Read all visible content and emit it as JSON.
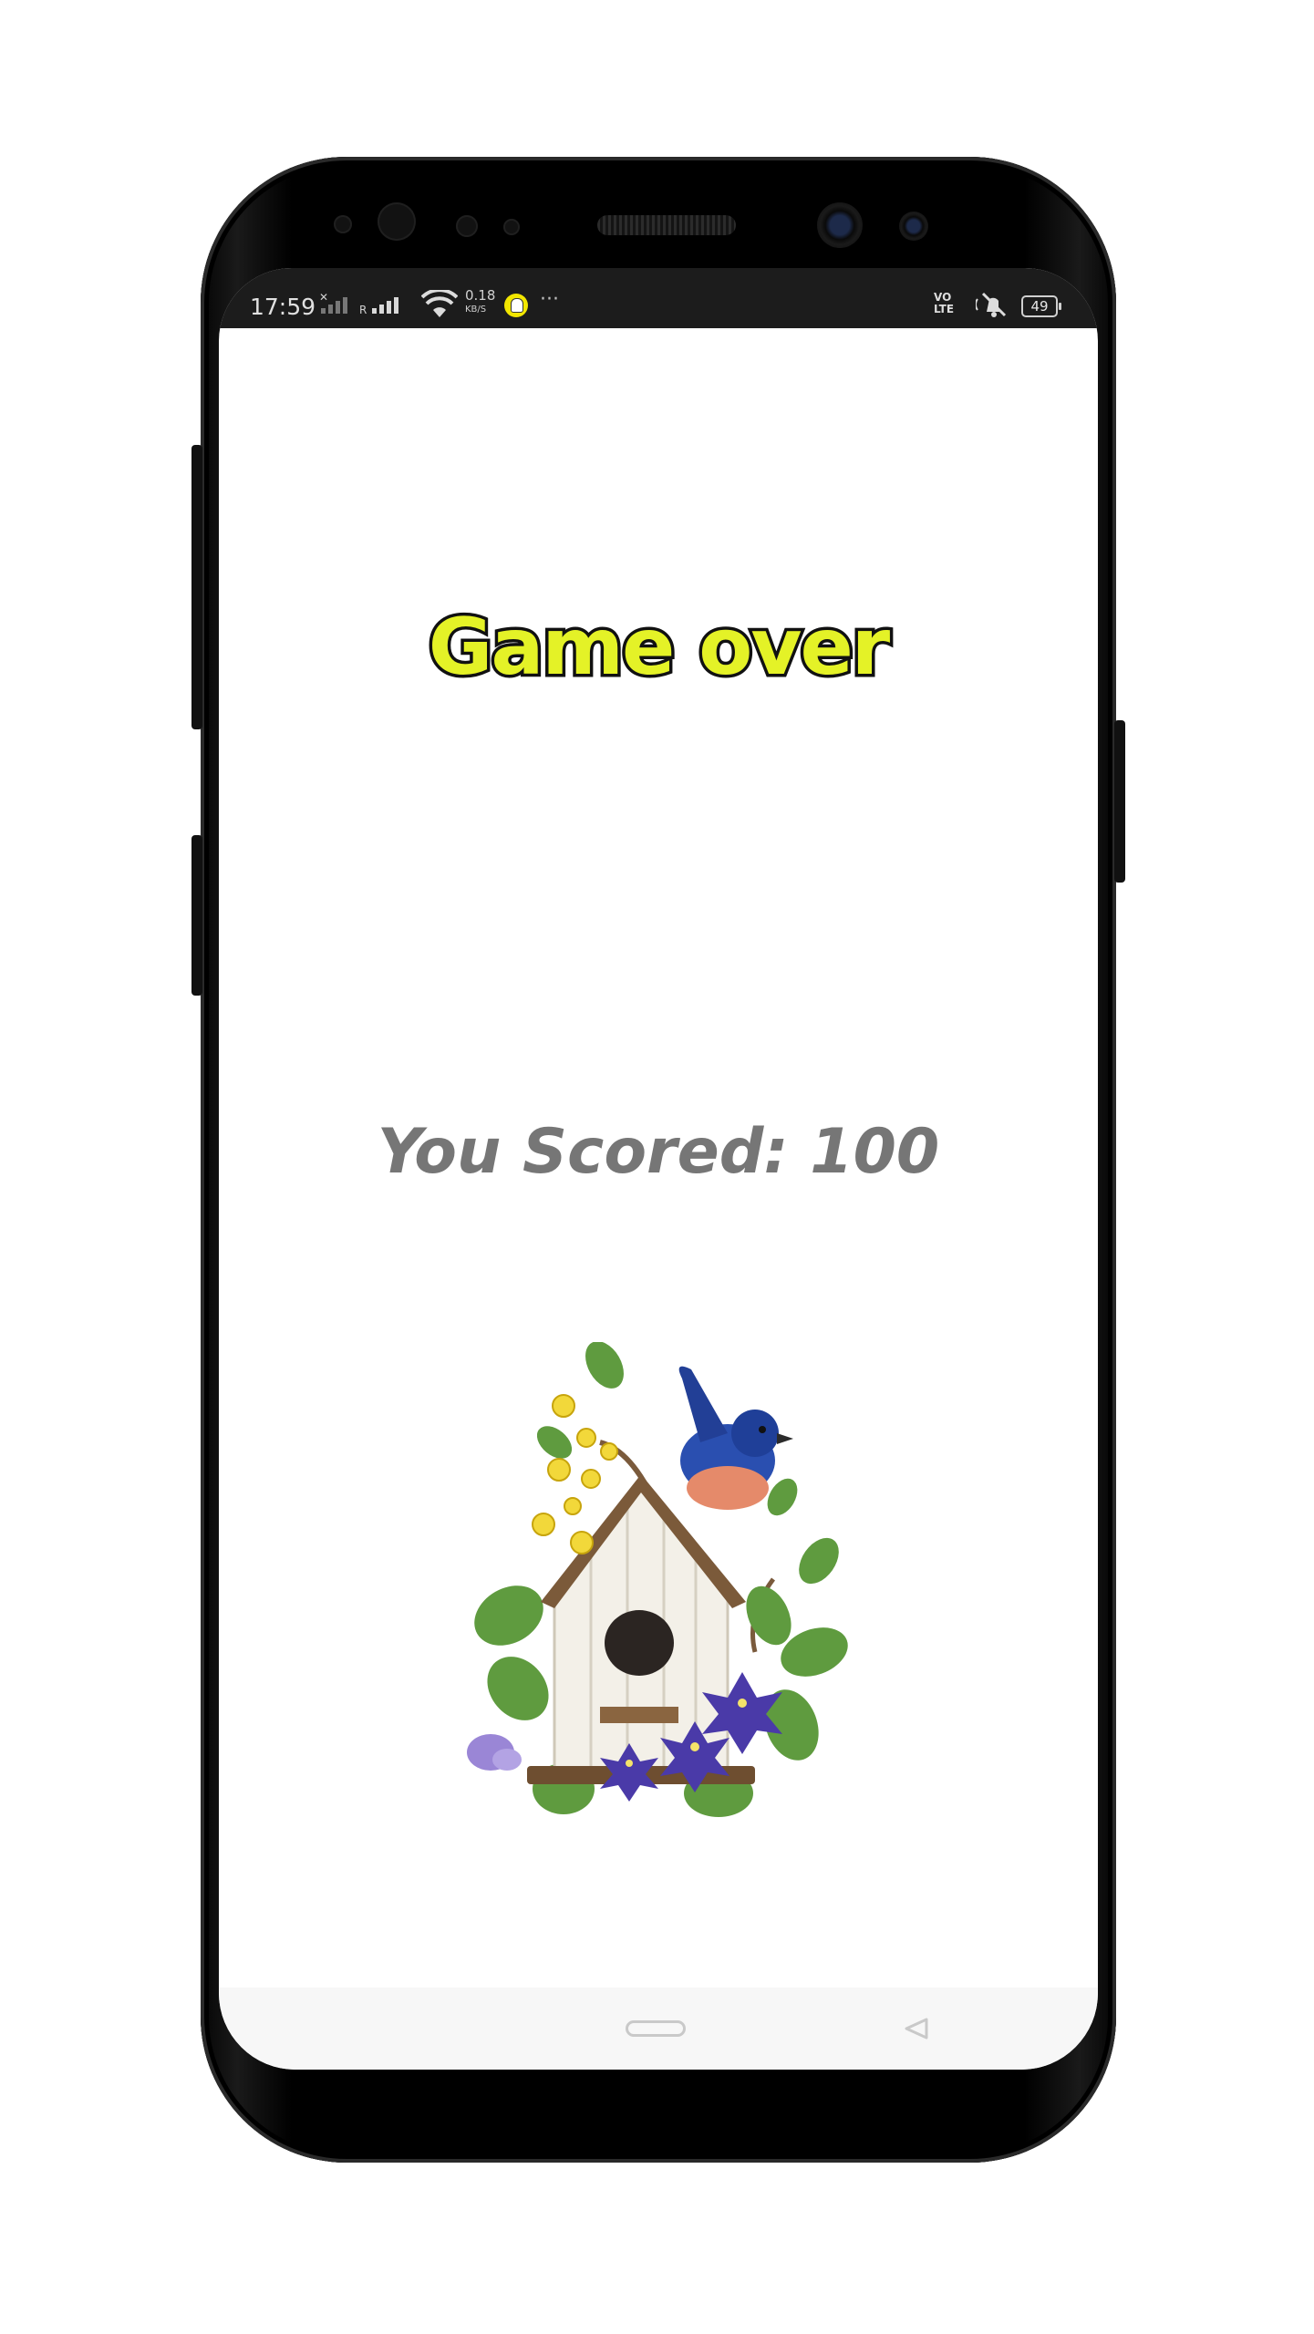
{
  "status_bar": {
    "time": "17:59",
    "roaming": "R",
    "speed_value": "0.18",
    "speed_unit": "KB/S",
    "overflow": "···",
    "volte_line1": "VO",
    "volte_line2": "LTE",
    "battery": "49"
  },
  "game": {
    "title": "Game over",
    "score_text": "You Scored: 100"
  },
  "colors": {
    "title_fill": "#e4f227",
    "title_outline": "#111111",
    "score_text": "#767676",
    "status_bar_bg": "#1c1c1c",
    "nav_bar_bg": "#f7f7f7"
  },
  "icons": {
    "artwork": "birdhouse-with-bluebird-illustration",
    "nav_home": "home-pill-icon",
    "nav_back": "back-triangle-icon"
  }
}
